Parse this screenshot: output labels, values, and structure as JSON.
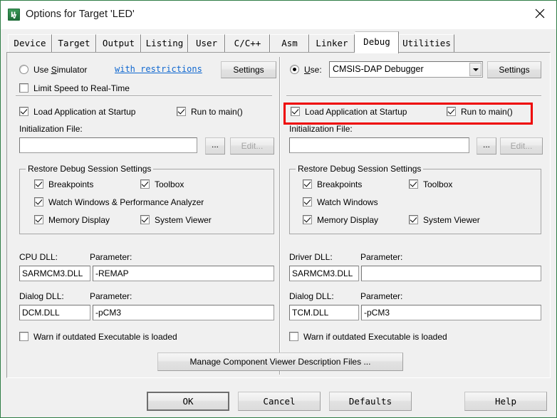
{
  "window": {
    "title": "Options for Target 'LED'",
    "icon": "uvision-icon",
    "close_icon": "close-icon",
    "border_color": "#2f7d46"
  },
  "tabs": [
    {
      "label": "Device",
      "active": false
    },
    {
      "label": "Target",
      "active": false
    },
    {
      "label": "Output",
      "active": false
    },
    {
      "label": "Listing",
      "active": false
    },
    {
      "label": "User",
      "active": false
    },
    {
      "label": "C/C++",
      "active": false
    },
    {
      "label": "Asm",
      "active": false
    },
    {
      "label": "Linker",
      "active": false
    },
    {
      "label": "Debug",
      "active": true
    },
    {
      "label": "Utilities",
      "active": false
    }
  ],
  "left_panel": {
    "use_simulator_radio": {
      "label_pre": "Use ",
      "label_key": "S",
      "label_post": "imulator",
      "checked": false
    },
    "restrictions_link": "with restrictions",
    "settings_button": "Settings",
    "limit_speed_checkbox": {
      "label": "Limit Speed to Real-Time",
      "checked": false
    },
    "load_app_checkbox": {
      "label": "Load Application at Startup",
      "checked": true
    },
    "run_to_main_checkbox": {
      "label": "Run to main()",
      "checked": true
    },
    "init_file_label": "Initialization File:",
    "init_file_value": "",
    "browse_button": "...",
    "edit_button": "Edit...",
    "edit_button_disabled": true,
    "restore_group": {
      "title": "Restore Debug Session Settings",
      "items": [
        {
          "label": "Breakpoints",
          "checked": true
        },
        {
          "label": "Toolbox",
          "checked": true
        },
        {
          "label": "Watch Windows & Performance Analyzer",
          "checked": true
        },
        {
          "label": "Memory Display",
          "checked": true
        },
        {
          "label": "System Viewer",
          "checked": true
        }
      ]
    },
    "dll_rows": [
      {
        "name_label": "CPU DLL:",
        "name_value": "SARMCM3.DLL",
        "param_label": "Parameter:",
        "param_value": "-REMAP"
      },
      {
        "name_label": "Dialog DLL:",
        "name_value": "DCM.DLL",
        "param_label": "Parameter:",
        "param_value": "-pCM3"
      }
    ],
    "warn_checkbox": {
      "label": "Warn if outdated Executable is loaded",
      "checked": false
    }
  },
  "right_panel": {
    "use_radio": {
      "label_key": "U",
      "label_post": "se:",
      "checked": true
    },
    "debugger_select": {
      "value": "CMSIS-DAP Debugger"
    },
    "settings_button": "Settings",
    "load_app_checkbox": {
      "label": "Load Application at Startup",
      "checked": true
    },
    "run_to_main_checkbox": {
      "label": "Run to main()",
      "checked": true
    },
    "init_file_label": "Initialization File:",
    "init_file_value": "",
    "browse_button": "...",
    "edit_button": "Edit...",
    "edit_button_disabled": true,
    "restore_group": {
      "title": "Restore Debug Session Settings",
      "items": [
        {
          "label": "Breakpoints",
          "checked": true
        },
        {
          "label": "Toolbox",
          "checked": true
        },
        {
          "label": "Watch Windows",
          "checked": true
        },
        {
          "label": "Memory Display",
          "checked": true
        },
        {
          "label": "System Viewer",
          "checked": true
        }
      ]
    },
    "dll_rows": [
      {
        "name_label": "Driver DLL:",
        "name_value": "SARMCM3.DLL",
        "param_label": "Parameter:",
        "param_value": ""
      },
      {
        "name_label": "Dialog DLL:",
        "name_value": "TCM.DLL",
        "param_label": "Parameter:",
        "param_value": "-pCM3"
      }
    ],
    "warn_checkbox": {
      "label": "Warn if outdated Executable is loaded",
      "checked": false
    }
  },
  "manage_button": "Manage Component Viewer Description Files ...",
  "footer": {
    "ok": "OK",
    "cancel": "Cancel",
    "defaults": "Defaults",
    "help": "Help"
  },
  "annotation": {
    "highlight_color": "#ee0000"
  }
}
